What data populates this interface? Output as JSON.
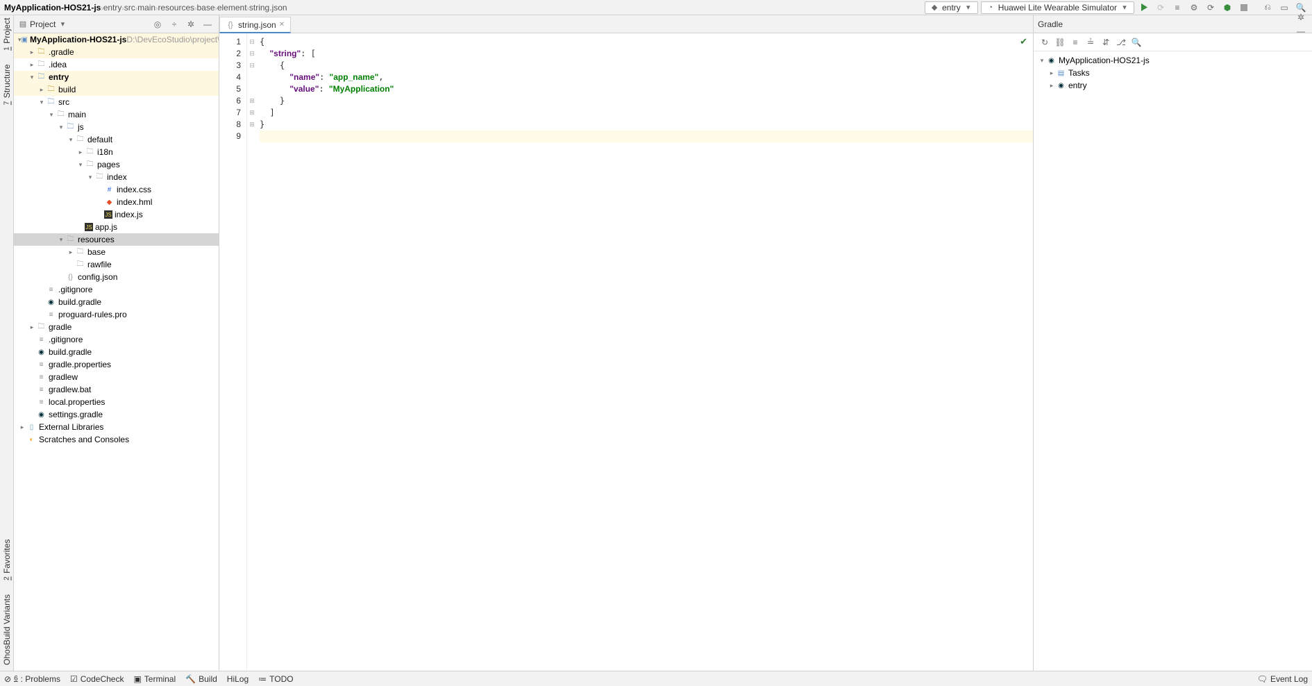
{
  "breadcrumb": [
    "MyApplication-HOS21-js",
    "entry",
    "src",
    "main",
    "resources",
    "base",
    "element",
    "string.json"
  ],
  "top": {
    "module": "entry",
    "device": "Huawei Lite Wearable Simulator"
  },
  "project_panel": {
    "title": "Project",
    "tree": [
      {
        "d": 0,
        "a": "v",
        "i": "project",
        "t": "MyApplication-HOS21-js",
        "b": true,
        "hint": " D:\\DevEcoStudio\\project\\MyAp",
        "hl": true
      },
      {
        "d": 1,
        "a": ">",
        "i": "fold",
        "t": ".gradle",
        "hl": true
      },
      {
        "d": 1,
        "a": ">",
        "i": "fold-gray",
        "t": ".idea"
      },
      {
        "d": 1,
        "a": "v",
        "i": "fold-blue",
        "t": "entry",
        "b": true,
        "hl": true
      },
      {
        "d": 2,
        "a": ">",
        "i": "fold",
        "t": "build",
        "hl": true
      },
      {
        "d": 2,
        "a": "v",
        "i": "fold-blue",
        "t": "src"
      },
      {
        "d": 3,
        "a": "v",
        "i": "fold-gray",
        "t": "main"
      },
      {
        "d": 4,
        "a": "v",
        "i": "fold-blue",
        "t": "js"
      },
      {
        "d": 5,
        "a": "v",
        "i": "fold-gray",
        "t": "default"
      },
      {
        "d": 6,
        "a": ">",
        "i": "fold-gray",
        "t": "i18n"
      },
      {
        "d": 6,
        "a": "v",
        "i": "fold-gray",
        "t": "pages"
      },
      {
        "d": 7,
        "a": "v",
        "i": "fold-gray",
        "t": "index"
      },
      {
        "d": 8,
        "a": "",
        "i": "css",
        "t": "index.css"
      },
      {
        "d": 8,
        "a": "",
        "i": "hml",
        "t": "index.hml"
      },
      {
        "d": 8,
        "a": "",
        "i": "js",
        "t": "index.js"
      },
      {
        "d": 6,
        "a": "",
        "i": "js",
        "t": "app.js"
      },
      {
        "d": 4,
        "a": "v",
        "i": "fold-gray",
        "t": "resources",
        "sel": true
      },
      {
        "d": 5,
        "a": ">",
        "i": "fold-gray",
        "t": "base"
      },
      {
        "d": 5,
        "a": "",
        "i": "fold-gray",
        "t": "rawfile"
      },
      {
        "d": 4,
        "a": "",
        "i": "json",
        "t": "config.json"
      },
      {
        "d": 2,
        "a": "",
        "i": "file",
        "t": ".gitignore"
      },
      {
        "d": 2,
        "a": "",
        "i": "gradle",
        "t": "build.gradle"
      },
      {
        "d": 2,
        "a": "",
        "i": "file",
        "t": "proguard-rules.pro"
      },
      {
        "d": 1,
        "a": ">",
        "i": "fold-gray",
        "t": "gradle"
      },
      {
        "d": 1,
        "a": "",
        "i": "file",
        "t": ".gitignore"
      },
      {
        "d": 1,
        "a": "",
        "i": "gradle",
        "t": "build.gradle"
      },
      {
        "d": 1,
        "a": "",
        "i": "file",
        "t": "gradle.properties"
      },
      {
        "d": 1,
        "a": "",
        "i": "file",
        "t": "gradlew"
      },
      {
        "d": 1,
        "a": "",
        "i": "file",
        "t": "gradlew.bat"
      },
      {
        "d": 1,
        "a": "",
        "i": "file",
        "t": "local.properties"
      },
      {
        "d": 1,
        "a": "",
        "i": "gradle",
        "t": "settings.gradle"
      },
      {
        "d": 0,
        "a": ">",
        "i": "lib",
        "t": "External Libraries"
      },
      {
        "d": 0,
        "a": "",
        "i": "scratch",
        "t": "Scratches and Consoles"
      }
    ]
  },
  "editor": {
    "tab": "string.json",
    "lines": [
      "{",
      "  \"string\": [",
      "    {",
      "      \"name\": \"app_name\",",
      "      \"value\": \"MyApplication\"",
      "    }",
      "  ]",
      "}",
      ""
    ]
  },
  "gradle": {
    "title": "Gradle",
    "tree": [
      {
        "d": 0,
        "a": "v",
        "i": "gradle",
        "t": "MyApplication-HOS21-js"
      },
      {
        "d": 1,
        "a": ">",
        "i": "tasks",
        "t": "Tasks"
      },
      {
        "d": 1,
        "a": ">",
        "i": "gradle",
        "t": "entry"
      }
    ]
  },
  "left_labels": {
    "project": "1: Project",
    "structure": "7: Structure",
    "favorites": "2: Favorites",
    "variants": "OhosBuild Variants"
  },
  "status": {
    "problems": "6: Problems",
    "codecheck": "CodeCheck",
    "terminal": "Terminal",
    "build": "Build",
    "hilog": "HiLog",
    "todo": "TODO",
    "eventlog": "Event Log"
  }
}
